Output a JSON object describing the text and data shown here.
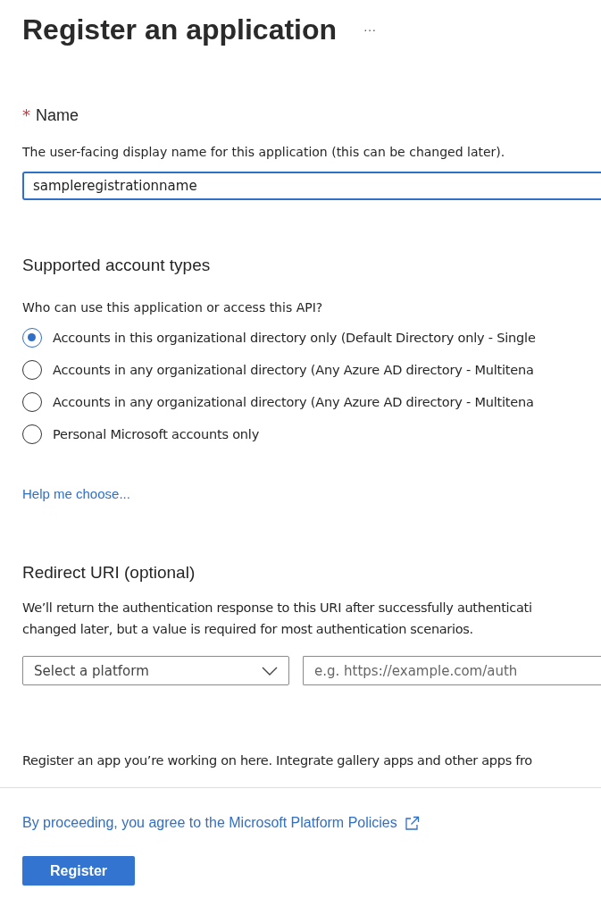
{
  "header": {
    "title": "Register an application",
    "more": "···"
  },
  "name_section": {
    "label": "Name",
    "required_mark": "*",
    "description": "The user-facing display name for this application (this can be changed later).",
    "value": "sampleregistrationname"
  },
  "account_types": {
    "heading": "Supported account types",
    "question": "Who can use this application or access this API?",
    "options": [
      {
        "label": "Accounts in this organizational directory only (Default Directory only - Single",
        "selected": true
      },
      {
        "label": "Accounts in any organizational directory (Any Azure AD directory - Multitena",
        "selected": false
      },
      {
        "label": "Accounts in any organizational directory (Any Azure AD directory - Multitena",
        "selected": false
      },
      {
        "label": "Personal Microsoft accounts only",
        "selected": false
      }
    ],
    "help_link": "Help me choose..."
  },
  "redirect": {
    "heading": "Redirect URI (optional)",
    "description_lines": [
      "We’ll return the authentication response to this URI after successfully authenticati",
      "changed later, but a value is required for most authentication scenarios."
    ],
    "platform_placeholder": "Select a platform",
    "uri_placeholder": "e.g. https://example.com/auth"
  },
  "note": "Register an app you’re working on here. Integrate gallery apps and other apps fro",
  "footer": {
    "policy_link": "By proceeding, you agree to the Microsoft Platform Policies",
    "register_button": "Register"
  }
}
